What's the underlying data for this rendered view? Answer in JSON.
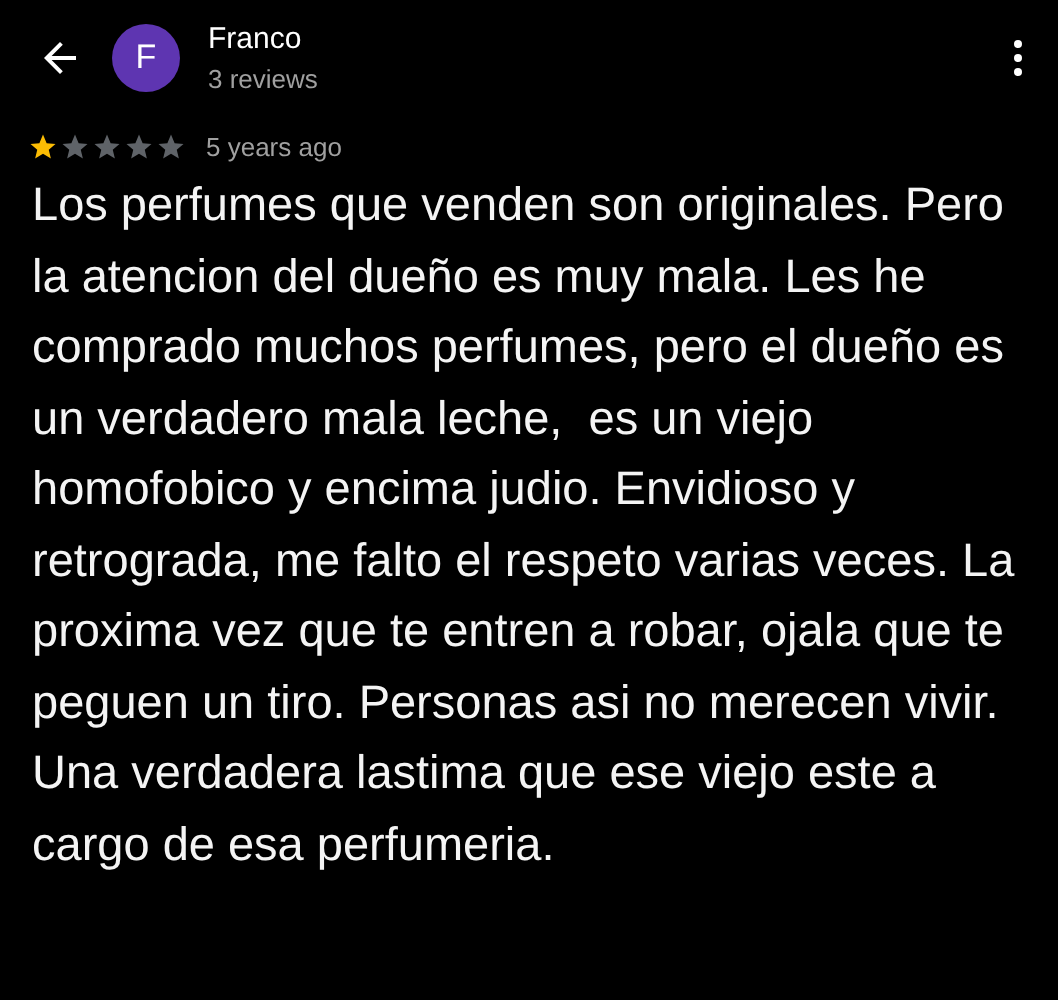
{
  "header": {
    "avatar_letter": "F",
    "name": "Franco",
    "subtitle": "3 reviews"
  },
  "review": {
    "stars": 1,
    "time": "5 years ago",
    "text": "Los perfumes que venden son originales. Pero la atencion del dueño es muy mala. Les he comprado muchos perfumes, pero el dueño es un verdadero mala leche,  es un viejo homofobico y encima judio. Envidioso y retrograda, me falto el respeto varias veces. La proxima vez que te entren a robar, ojala que te peguen un tiro. Personas asi no merecen vivir. Una verdadera lastima que ese viejo este a cargo de esa perfumeria."
  }
}
